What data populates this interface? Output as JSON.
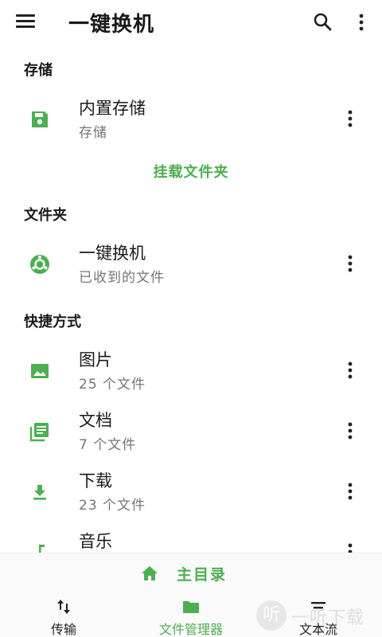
{
  "app_bar": {
    "title": "一键换机",
    "menu_icon": "hamburger-menu-icon",
    "search_icon": "search-icon",
    "more_icon": "more-vert-icon"
  },
  "sections": {
    "storage": {
      "title": "存储",
      "items": [
        {
          "name": "内置存储",
          "sub": "存储",
          "icon": "save-icon"
        }
      ],
      "mount_label": "挂载文件夹"
    },
    "folders": {
      "title": "文件夹",
      "items": [
        {
          "name": "一键换机",
          "sub": "已收到的文件",
          "icon": "app-logo-icon"
        }
      ]
    },
    "shortcuts": {
      "title": "快捷方式",
      "items": [
        {
          "name": "图片",
          "sub": "25 个文件",
          "icon": "image-icon"
        },
        {
          "name": "文档",
          "sub": "7 个文件",
          "icon": "document-library-icon"
        },
        {
          "name": "下载",
          "sub": "23 个文件",
          "icon": "download-icon"
        },
        {
          "name": "音乐",
          "sub": "",
          "icon": "music-note-icon"
        }
      ]
    }
  },
  "bottom_bar": {
    "home_label": "主目录",
    "tabs": [
      {
        "label": "传输",
        "icon": "swap-vertical-icon",
        "selected": false
      },
      {
        "label": "文件管理器",
        "icon": "folder-icon",
        "selected": true
      },
      {
        "label": "文本流",
        "icon": "text-stream-icon",
        "selected": false
      }
    ]
  },
  "watermark": {
    "glyph": "听",
    "text": "一听下载"
  },
  "colors": {
    "accent": "#4caf50",
    "text_primary": "#1a1a1a",
    "text_secondary": "#757575",
    "background": "#ffffff"
  }
}
